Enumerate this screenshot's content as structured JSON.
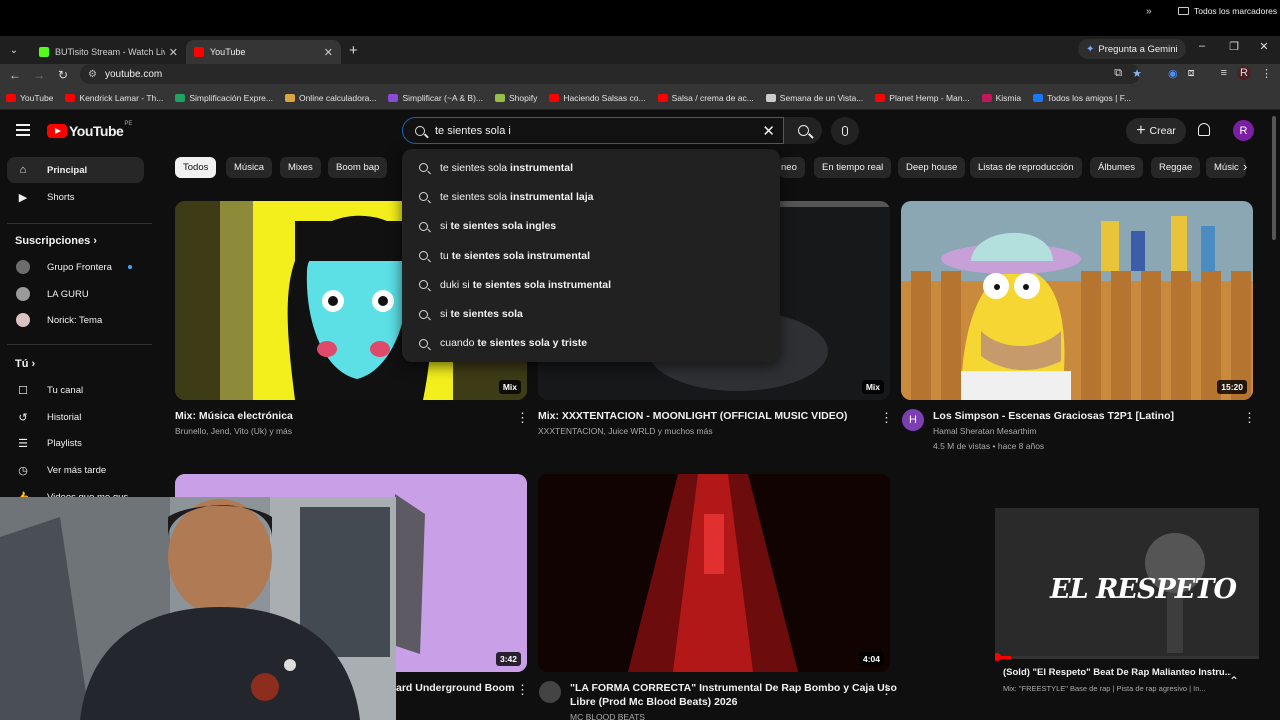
{
  "browser": {
    "tabs": [
      {
        "label": "BUTisito Stream - Watch Live o",
        "color": "#53fc18"
      },
      {
        "label": "YouTube",
        "color": "#ff0000"
      }
    ],
    "gemini_label": "Pregunta a Gemini",
    "url": "youtube.com",
    "profile_initial": "R"
  },
  "bookmarks": [
    {
      "label": "YouTube",
      "color": "#ff0000"
    },
    {
      "label": "Kendrick Lamar - Th...",
      "color": "#ff0000"
    },
    {
      "label": "Simplificación Expre...",
      "color": "#1ea362"
    },
    {
      "label": "Online calculadora...",
      "color": "#d9a441"
    },
    {
      "label": "Simplificar (~A & B)...",
      "color": "#8a4bd8"
    },
    {
      "label": "Shopify",
      "color": "#95bf47"
    },
    {
      "label": "Haciendo Salsas co...",
      "color": "#ff0000"
    },
    {
      "label": "Salsa / crema de ac...",
      "color": "#ff0000"
    },
    {
      "label": "Semana de un Vista...",
      "color": "#cccccc"
    },
    {
      "label": "Planet Hemp - Man...",
      "color": "#ff0000"
    },
    {
      "label": "Kismia",
      "color": "#c2185b"
    },
    {
      "label": "Todos los amigos | F...",
      "color": "#1877f2"
    }
  ],
  "bookmarks_all": "Todos los marcadores",
  "header": {
    "logo_text": "YouTube",
    "region": "PE",
    "search_value": "te sientes sola i",
    "create_label": "Crear",
    "avatar_initial": "R"
  },
  "suggestions": [
    {
      "typed": "te sientes sola ",
      "rest": "instrumental"
    },
    {
      "typed": "te sientes sola ",
      "rest": "instrumental laja"
    },
    {
      "typed": "si ",
      "rest": "te sientes sola ingles"
    },
    {
      "typed": "tu ",
      "rest": "te sientes sola instrumental"
    },
    {
      "typed": "duki si ",
      "rest": "te sientes sola instrumental"
    },
    {
      "typed": "si ",
      "rest": "te sientes sola"
    },
    {
      "typed": "cuando ",
      "rest": "te sientes sola y triste"
    }
  ],
  "sidebar": {
    "main": [
      {
        "label": "Principal",
        "icon": "home-icon"
      },
      {
        "label": "Shorts",
        "icon": "shorts-icon"
      }
    ],
    "subscriptions_title": "Suscripciones",
    "subscriptions": [
      {
        "label": "Grupo Frontera"
      },
      {
        "label": "LA GURU"
      },
      {
        "label": "Norick: Tema"
      }
    ],
    "you_title": "Tú",
    "you_items": [
      {
        "label": "Tu canal",
        "icon": "channel-icon"
      },
      {
        "label": "Historial",
        "icon": "history-icon"
      },
      {
        "label": "Playlists",
        "icon": "playlists-icon"
      },
      {
        "label": "Ver más tarde",
        "icon": "watch-later-icon"
      },
      {
        "label": "Videos que me gus...",
        "icon": "liked-icon"
      }
    ]
  },
  "chips": [
    "Todos",
    "Música",
    "Mixes",
    "Boom bap",
    "neo",
    "En tiempo real",
    "Deep house",
    "Listas de reproducción",
    "Álbumes",
    "Reggae",
    "Músic"
  ],
  "videos": [
    {
      "title": "Mix: Música electrónica",
      "meta": "Brunello, Jend, Vito (Uk) y más",
      "badge": "Mix"
    },
    {
      "title": "Mix: XXXTENTACION - MOONLIGHT (OFFICIAL MUSIC VIDEO)",
      "meta": "XXXTENTACION, Juice WRLD y muchos más",
      "badge": "Mix"
    },
    {
      "title": "Los Simpson - Escenas Graciosas T2P1 [Latino]",
      "channel": "Hamal Sheratan Mesarthim",
      "meta": "4.5 M de vistas • hace 8 años",
      "badge": "15:20",
      "avatar": "H"
    },
    {
      "title": "ard Underground Boom",
      "badge": "3:42"
    },
    {
      "title": "\"LA FORMA CORRECTA\" Instrumental De Rap Bombo y Caja Uso",
      "title2": "Libre (Prod Mc Blood Beats) 2026",
      "channel": "MC BLOOD BEATS",
      "badge": "4:04"
    },
    {
      "title": "(Sold) \"El Respeto\" Beat De Rap Malianteo Instru...",
      "meta": "Mix: \"FREESTYLE\" Base de rap | Pista de rap agresivo | In...",
      "overlay": "EL RESPETO"
    }
  ]
}
